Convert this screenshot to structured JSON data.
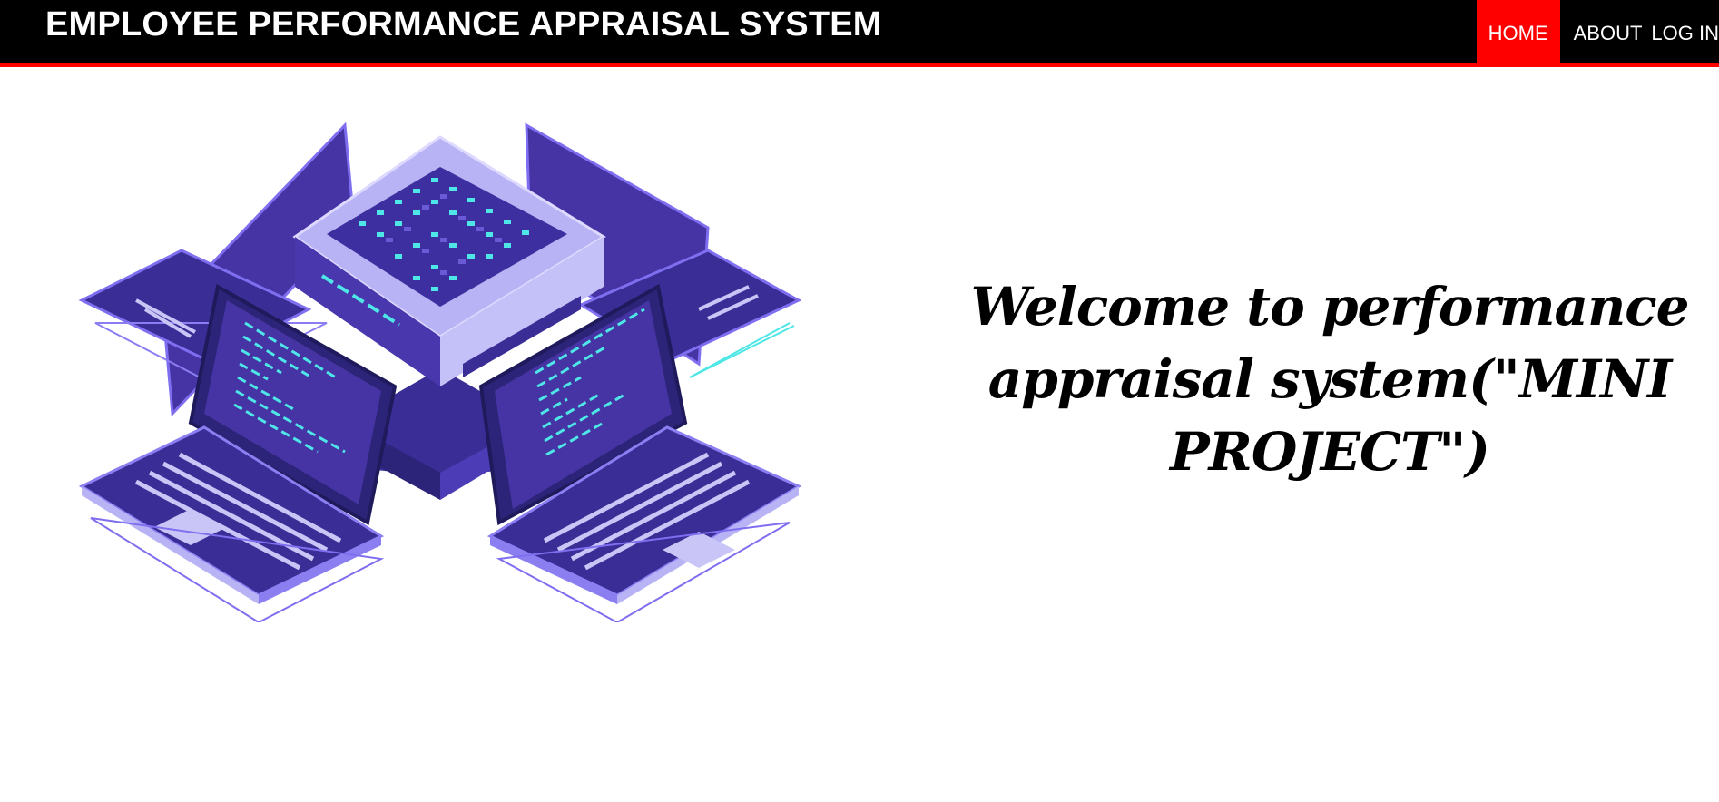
{
  "header": {
    "title": "EMPLOYEE PERFORMANCE APPRAISAL SYSTEM",
    "nav": [
      {
        "label": "HOME",
        "active": true
      },
      {
        "label": "ABOUT",
        "active": false
      },
      {
        "label": "LOG IN",
        "active": false
      }
    ]
  },
  "main": {
    "illustration_icon": "isometric-laptops-server-icon",
    "welcome_text": "Welcome to performance appraisal system(\"MINI PROJECT\")"
  },
  "colors": {
    "navbar_bg": "#000000",
    "accent": "#ff0000",
    "illustration_primary": "#3f2f9e",
    "illustration_light": "#c9c6f7",
    "illustration_cyan": "#4ee6e6"
  }
}
